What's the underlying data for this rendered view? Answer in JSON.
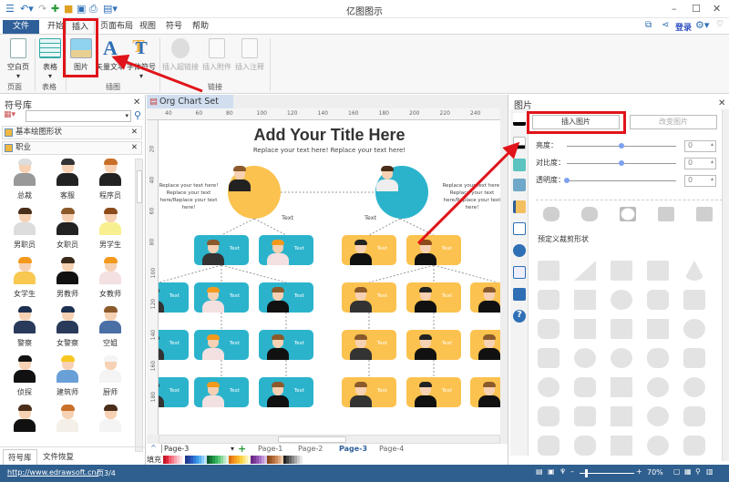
{
  "app_title": "亿图图示",
  "title_right": {
    "login": "登录"
  },
  "tabs": [
    "文件",
    "开始",
    "插入",
    "页面布局",
    "视图",
    "符号",
    "帮助"
  ],
  "active_tab": "插入",
  "ribbon": {
    "buttons": [
      {
        "label": "空白页",
        "enabled": true,
        "icon": "blank-page-icon"
      },
      {
        "label": "表格",
        "enabled": true,
        "icon": "table-icon"
      },
      {
        "label": "图片",
        "enabled": true,
        "icon": "picture-icon"
      },
      {
        "label": "矢量文本",
        "enabled": true,
        "icon": "vector-text-icon"
      },
      {
        "label": "字体符号",
        "enabled": true,
        "icon": "font-symbol-icon"
      },
      {
        "label": "插入超链接",
        "enabled": false,
        "icon": "hyperlink-icon"
      },
      {
        "label": "插入附件",
        "enabled": false,
        "icon": "attachment-icon"
      },
      {
        "label": "插入注释",
        "enabled": false,
        "icon": "comment-icon"
      }
    ],
    "groups": [
      "页面",
      "表格",
      "插图",
      "链接"
    ]
  },
  "library": {
    "title": "符号库",
    "search_placeholder": "",
    "categories": [
      "基本绘图形状",
      "职业"
    ],
    "symbols": [
      "总裁",
      "客服",
      "程序员",
      "男职员",
      "女职员",
      "男学生",
      "女学生",
      "男教师",
      "女教师",
      "警察",
      "女警察",
      "空姐",
      "侦探",
      "建筑师",
      "厨师",
      "",
      "",
      ""
    ],
    "bottom_tabs": [
      "符号库",
      "文件恢复"
    ]
  },
  "document": {
    "tab": "Org Chart Set 4",
    "ruler_h": [
      "40",
      "60",
      "80",
      "100",
      "120",
      "140",
      "160",
      "180",
      "200",
      "220",
      "240"
    ],
    "ruler_v": [
      "20",
      "40",
      "60",
      "80",
      "100",
      "120",
      "140",
      "160",
      "180"
    ],
    "title": "Add Your Title Here",
    "subtitle": "Replace your text here!   Replace your text here!",
    "side_text_left": "Replace your text here! Replace your text here/Replace your text here!",
    "side_text_right": "Replace your text here! Replace your text here/Replace your text here!",
    "node_label": "Text",
    "card_label": "Text",
    "colors": {
      "teal": "#2bb3cc",
      "orange": "#fcc24f"
    }
  },
  "pages": {
    "current": "Page-3",
    "list": [
      "Page-1",
      "Page-2",
      "Page-3",
      "Page-4"
    ],
    "active": "Page-3"
  },
  "fill_label": "填充",
  "picture_panel": {
    "title": "图片",
    "insert_button": "插入图片",
    "change_button": "改变图片",
    "sliders": [
      {
        "label": "亮度：",
        "value": "0",
        "level": 0.5
      },
      {
        "label": "对比度：",
        "value": "0",
        "level": 0.5
      },
      {
        "label": "透明度：",
        "value": "0",
        "level": 0
      }
    ],
    "preset_label": "预定义裁剪形状"
  },
  "status": {
    "url": "http://www.edrawsoft.cn/",
    "page": "页3/4",
    "zoom": "70%"
  }
}
